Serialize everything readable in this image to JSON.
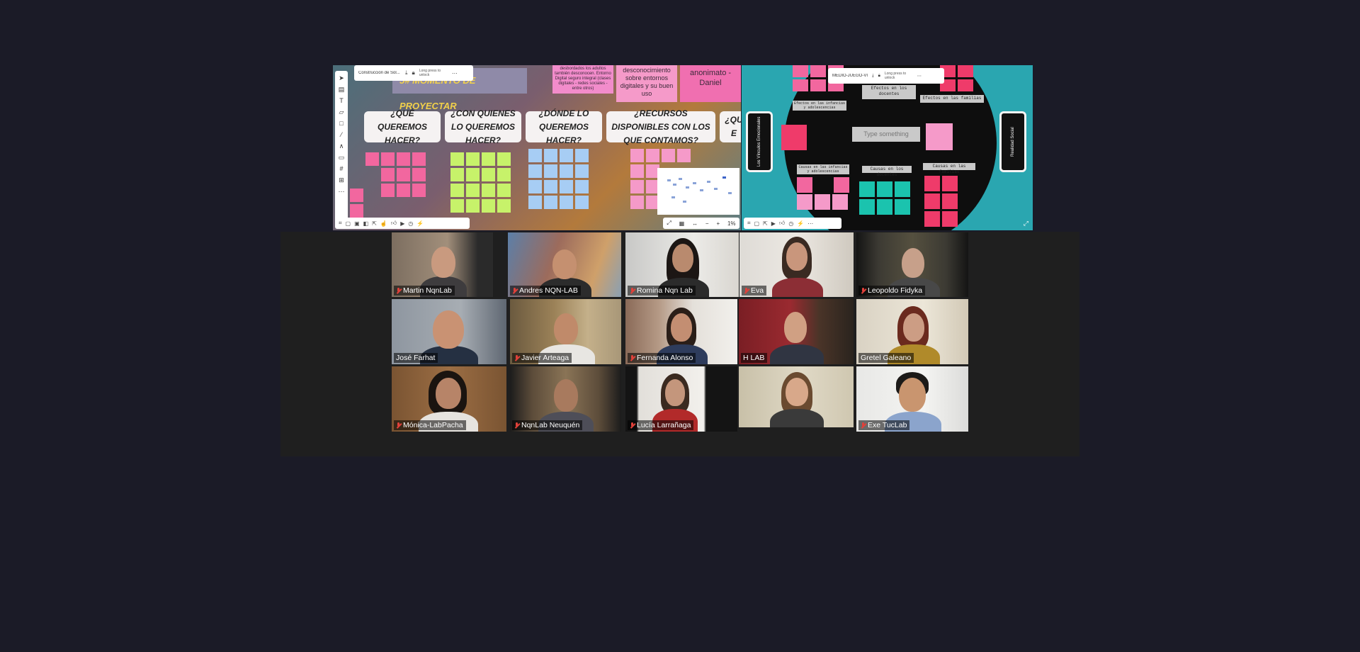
{
  "board1": {
    "file_name": "Construcción de Sol...",
    "lock_hint": "Long press to unlock",
    "title": "5# MOMENTO DE PROYECTAR",
    "note_top_1": "desbordados los adultos también desconocen. Entorno Digital seguro integral (clases digitales - redes sociales - entre otros)",
    "note_top_2": "desconocimiento sobre entornos digitales y su buen uso",
    "note_top_3": "anonimato - Daniel",
    "questions": [
      "¿QUÉ QUEREMOS HACER?",
      "¿CON QUIENES LO QUEREMOS HACER?",
      "¿DÓNDE LO QUEREMOS HACER?",
      "¿RECURSOS DISPONIBLES CON LOS QUE CONTAMOS?",
      "¿QU E"
    ],
    "zoom": "1%"
  },
  "board2": {
    "file_name": "MEDIO-JUEGO-VID-...",
    "lock_hint": "Long press to unlock",
    "left_card": "Los Vínculos Emocionales",
    "right_card": "Realidad Social",
    "labels": {
      "efectos_docentes": "Efectos en los docentes",
      "efectos_infancias": "Efectos en las infancias y adolescencias",
      "efectos_familias": "Efectos en las familias",
      "causas_infancias": "Causas en las infancias y adolescencias",
      "causas_docentes": "Causas en los docentes",
      "causas_familias": "Causas en las familias"
    },
    "type_placeholder": "Type something"
  },
  "participants": [
    {
      "name": "Martin NqnLab",
      "muted": true
    },
    {
      "name": "Andres NQN-LAB",
      "muted": true
    },
    {
      "name": "Romina Nqn Lab",
      "muted": true
    },
    {
      "name": "Eva",
      "muted": true
    },
    {
      "name": "Leopoldo Fidyka",
      "muted": true
    },
    {
      "name": "José Farhat",
      "muted": false
    },
    {
      "name": "Javier Arteaga",
      "muted": true
    },
    {
      "name": "Fernanda Alonso",
      "muted": true
    },
    {
      "name": "H LAB",
      "muted": false
    },
    {
      "name": "Gretel Galeano",
      "muted": false
    },
    {
      "name": "Mónica-LabPacha",
      "muted": true
    },
    {
      "name": "NqnLab Neuquén",
      "muted": true
    },
    {
      "name": "Lucía Larrañaga",
      "muted": true
    },
    {
      "name": "",
      "muted": false
    },
    {
      "name": "Exe TucLab",
      "muted": true
    }
  ],
  "colors": {
    "background": "#1b1b27",
    "active_speaker": "#d9e26b",
    "muted_mic": "#e0413a",
    "pink_note": "#f59ac9",
    "green_note": "#c7f26a",
    "blue_note": "#a7cdf4",
    "teal_note": "#1bc3ae"
  }
}
